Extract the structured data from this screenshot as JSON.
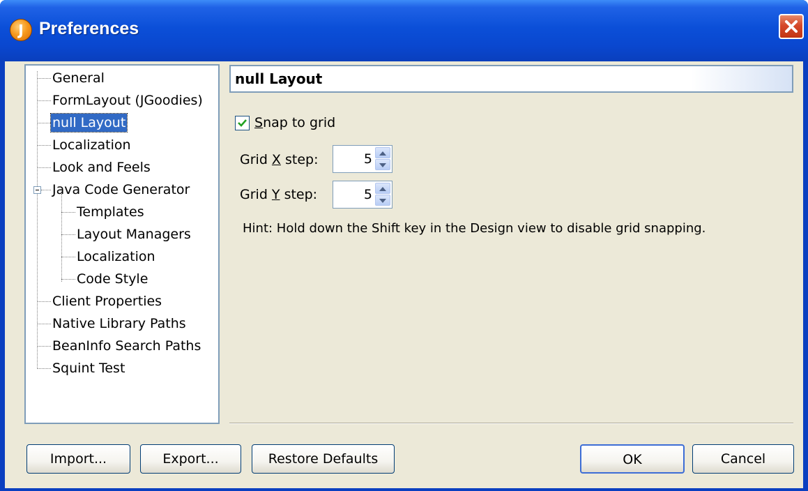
{
  "window": {
    "title": "Preferences",
    "app_icon_glyph": "J"
  },
  "tree": {
    "items": [
      {
        "label": "General"
      },
      {
        "label": "FormLayout (JGoodies)"
      },
      {
        "label": "null Layout",
        "selected": true
      },
      {
        "label": "Localization"
      },
      {
        "label": "Look and Feels"
      },
      {
        "label": "Java Code Generator",
        "expanded": true
      },
      {
        "label": "Templates"
      },
      {
        "label": "Layout Managers"
      },
      {
        "label": "Localization"
      },
      {
        "label": "Code Style"
      },
      {
        "label": "Client Properties"
      },
      {
        "label": "Native Library Paths"
      },
      {
        "label": "BeanInfo Search Paths"
      },
      {
        "label": "Squint Test"
      }
    ]
  },
  "panel": {
    "title": "null Layout",
    "snap": {
      "mnemonic": "S",
      "rest": "nap to grid",
      "checked": true
    },
    "grid_x": {
      "pre": "Grid ",
      "mnemonic": "X",
      "post": " step:",
      "value": "5"
    },
    "grid_y": {
      "pre": "Grid ",
      "mnemonic": "Y",
      "post": " step:",
      "value": "5"
    },
    "hint": "Hint: Hold down the Shift key in the Design view to disable grid snapping."
  },
  "buttons": {
    "import": "Import...",
    "export": "Export...",
    "restore": "Restore Defaults",
    "ok": "OK",
    "cancel": "Cancel"
  },
  "colors": {
    "titlebar": "#0a47cf",
    "selection": "#316ac5",
    "dialog_bg": "#ece9d8",
    "close": "#d5482a"
  }
}
